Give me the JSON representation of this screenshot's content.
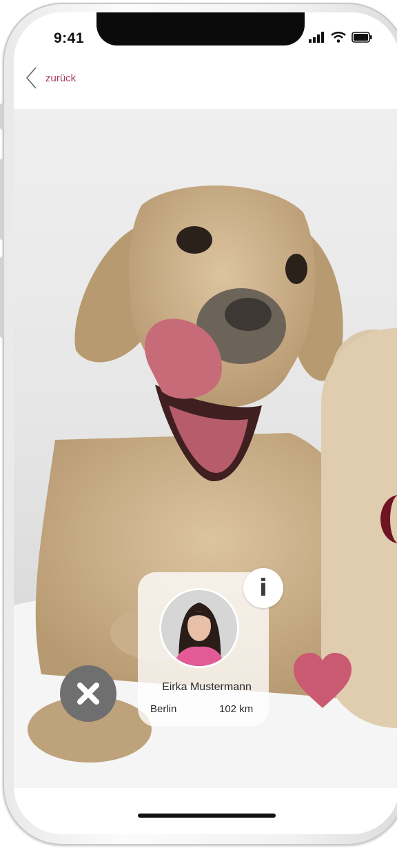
{
  "status_bar": {
    "time": "9:41",
    "icons": [
      "signal-icon",
      "wifi-icon",
      "battery-icon"
    ]
  },
  "nav": {
    "back_label": "zurück",
    "back_icon": "chevron-left-icon"
  },
  "photo": {
    "subject": "dog-photo"
  },
  "profile": {
    "name": "Eirka Mustermann",
    "city": "Berlin",
    "distance": "102 km",
    "info_label": "i"
  },
  "actions": {
    "dismiss_icon": "close-icon",
    "like_icon": "heart-icon"
  },
  "colors": {
    "accent": "#a23a58",
    "heart": "#c95a72",
    "dismiss_bg": "#6f6f70",
    "dog_fur": "#c7ad86",
    "cartoon": "#e0cdb0"
  }
}
